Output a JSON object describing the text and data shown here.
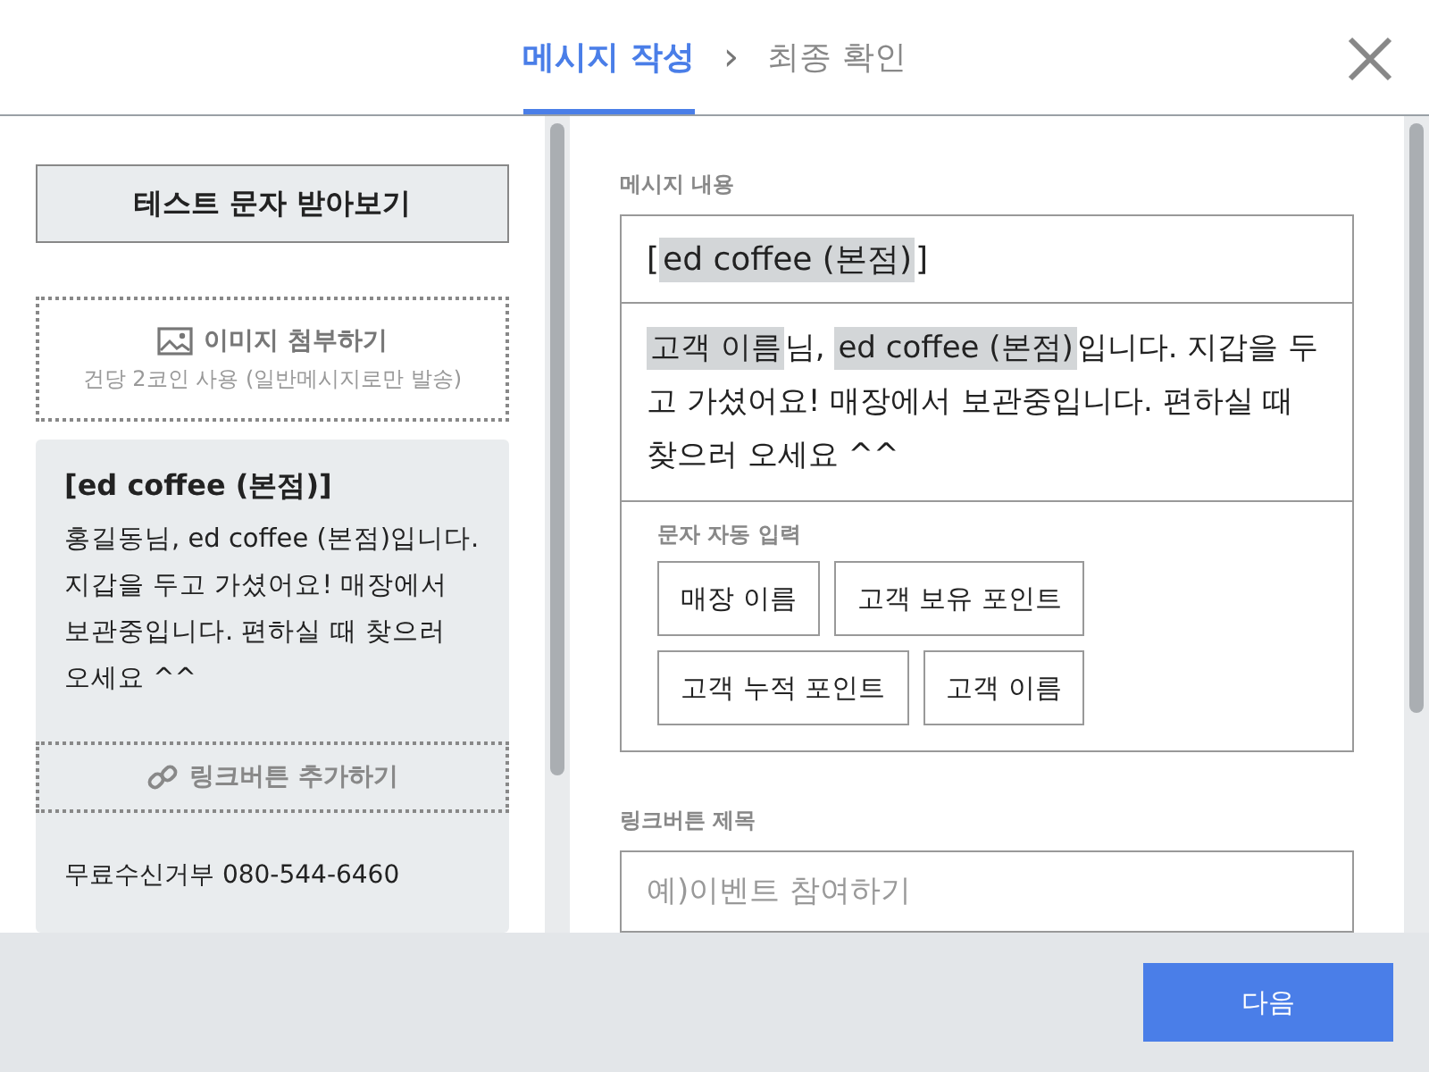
{
  "header": {
    "steps": [
      {
        "label": "메시지 작성",
        "selected": true
      },
      {
        "label": "최종 확인",
        "selected": false
      }
    ],
    "separator": "›"
  },
  "left": {
    "test_button": "테스트 문자 받아보기",
    "image_attach": {
      "label": "이미지 첨부하기",
      "note": "건당 2코인 사용 (일반메시지로만 발송)"
    },
    "preview": {
      "title": "[ed coffee (본점)]",
      "body": "홍길동님, ed coffee (본점)입니다. 지갑을 두고 가셨어요! 매장에서 보관중입니다. 편하실 때 찾으러 오세요 ^^",
      "link_button": "링크버튼 추가하기",
      "footer_text": "무료수신거부 080-544-6460"
    }
  },
  "right": {
    "message_label": "메시지 내용",
    "title_segments": [
      {
        "kind": "text",
        "text": "["
      },
      {
        "kind": "chip",
        "text": "ed coffee (본점)"
      },
      {
        "kind": "text",
        "text": "]"
      }
    ],
    "body_segments": [
      {
        "kind": "chip",
        "text": "고객 이름"
      },
      {
        "kind": "text",
        "text": "님, "
      },
      {
        "kind": "chip",
        "text": "ed coffee (본점)"
      },
      {
        "kind": "text",
        "text": "입니다. 지갑을 두고 가셨어요! 매장에서 보관중입니다. 편하실 때 찾으러 오세요 ^^"
      }
    ],
    "auto_input": {
      "label": "문자 자동 입력",
      "buttons": [
        "매장 이름",
        "고객 보유 포인트",
        "고객 누적 포인트",
        "고객 이름"
      ]
    },
    "link_title_label": "링크버튼 제목",
    "link_title_placeholder": "예)이벤트 참여하기"
  },
  "footer": {
    "next_button": "다음"
  }
}
